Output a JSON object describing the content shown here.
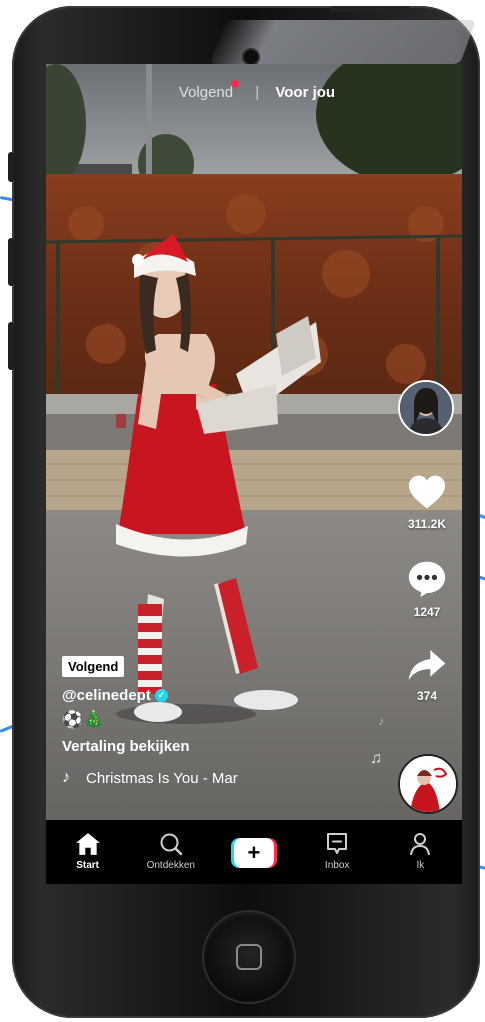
{
  "top_tabs": {
    "following": "Volgend",
    "for_you": "Voor jou"
  },
  "right_rail": {
    "like_count": "311.2K",
    "comment_count": "1247",
    "share_count": "374"
  },
  "caption": {
    "following_badge": "Volgend",
    "username": "@celinedept",
    "emojis": "⚽🎄",
    "translate_label": "Vertaling bekijken",
    "sound_title": "Christmas Is You - Mar"
  },
  "bottom_nav": {
    "home": "Start",
    "discover": "Ontdekken",
    "create": "+",
    "inbox": "Inbox",
    "profile": "Ik"
  },
  "colors": {
    "accent_red": "#fe2c55",
    "accent_cyan": "#20d5ec",
    "callout_blue": "#3d8bef"
  },
  "icons": [
    "heart-icon",
    "comment-icon",
    "share-icon",
    "music-note-icon",
    "home-icon",
    "search-icon",
    "inbox-icon",
    "profile-icon",
    "plus-icon",
    "verified-icon"
  ]
}
